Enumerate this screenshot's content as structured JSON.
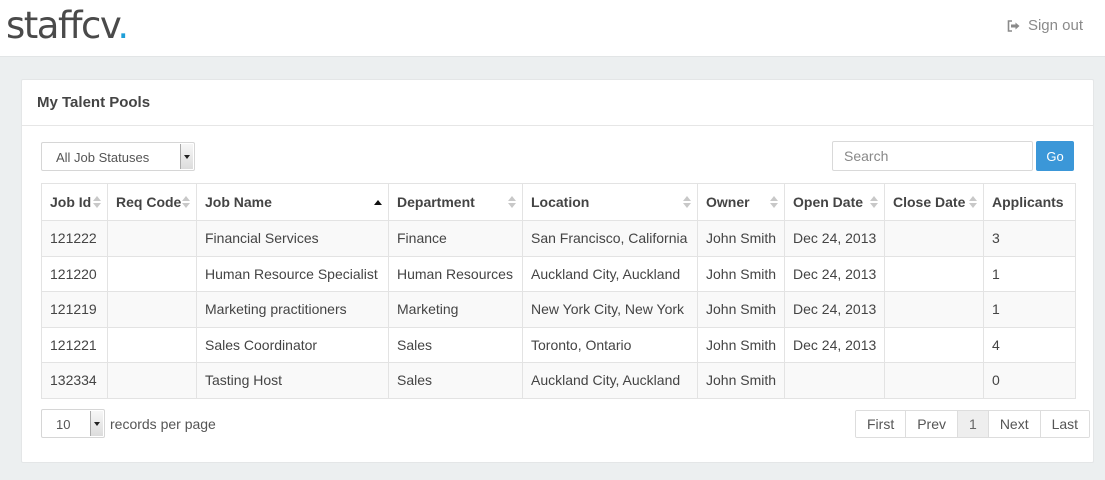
{
  "header": {
    "logo_text": "staffcv",
    "logo_dot": ".",
    "signout_label": "Sign out",
    "signout_icon": "sign-out-icon"
  },
  "panel": {
    "title": "My Talent Pools"
  },
  "filters": {
    "status_selected": "All Job Statuses",
    "search_placeholder": "Search",
    "go_label": "Go"
  },
  "table": {
    "columns": [
      "Job Id",
      "Req Code",
      "Job Name",
      "Department",
      "Location",
      "Owner",
      "Open Date",
      "Close Date",
      "Applicants"
    ],
    "sorted_column": "Job Name",
    "sort_direction": "ascending",
    "rows": [
      [
        "121222",
        "",
        "Financial Services",
        "Finance",
        "San Francisco, California",
        "John Smith",
        "Dec 24, 2013",
        "",
        "3"
      ],
      [
        "121220",
        "",
        "Human Resource Specialist",
        "Human Resources",
        "Auckland City, Auckland",
        "John Smith",
        "Dec 24, 2013",
        "",
        "1"
      ],
      [
        "121219",
        "",
        "Marketing practitioners",
        "Marketing",
        "New York City, New York",
        "John Smith",
        "Dec 24, 2013",
        "",
        "1"
      ],
      [
        "121221",
        "",
        "Sales Coordinator",
        "Sales",
        "Toronto, Ontario",
        "John Smith",
        "Dec 24, 2013",
        "",
        "4"
      ],
      [
        "132334",
        "",
        "Tasting Host",
        "Sales",
        "Auckland City, Auckland",
        "John Smith",
        "",
        "",
        "0"
      ]
    ]
  },
  "footer": {
    "per_page_value": "10",
    "per_page_label": "records per page",
    "pagination": {
      "first": "First",
      "prev": "Prev",
      "current": "1",
      "next": "Next",
      "last": "Last"
    }
  },
  "colors": {
    "accent": "#3b97d8",
    "logo_dot": "#1e9fd8",
    "background": "#eceff0"
  }
}
